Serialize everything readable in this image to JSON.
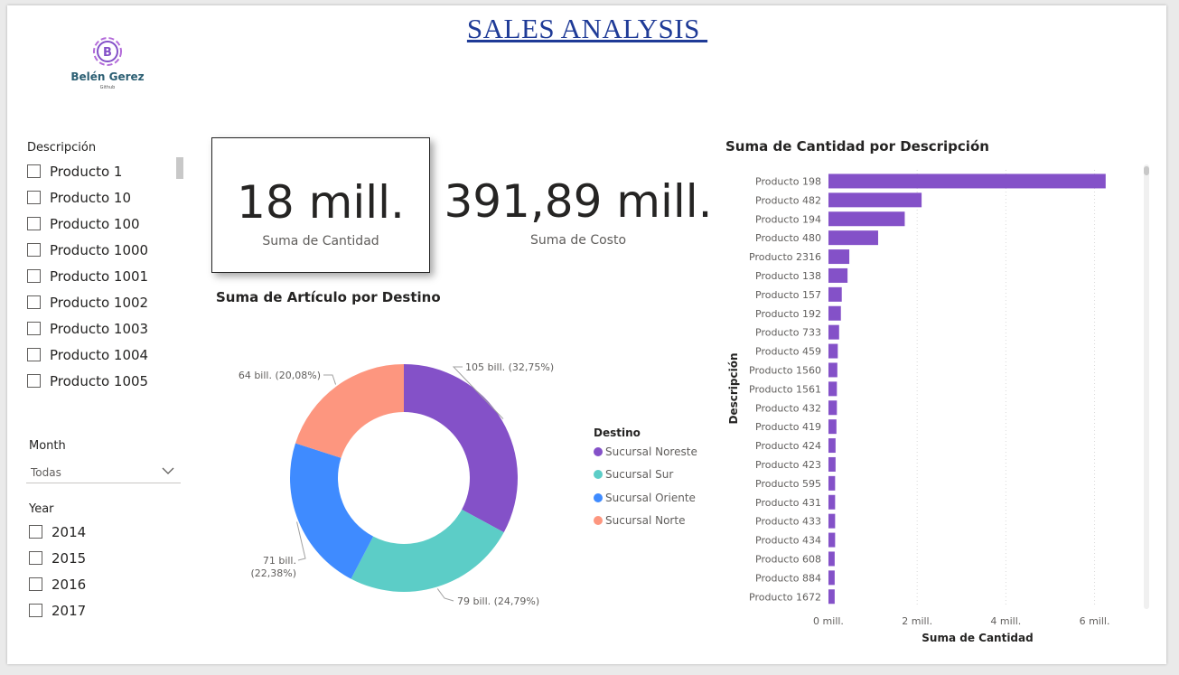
{
  "header": {
    "title": "SALES ANALYSIS "
  },
  "logo": {
    "letter": "B",
    "brand": "Belén Gerez",
    "sub": "Github"
  },
  "slicer_descripcion": {
    "title": "Descripción",
    "items": [
      "Producto 1",
      "Producto 10",
      "Producto 100",
      "Producto 1000",
      "Producto 1001",
      "Producto 1002",
      "Producto 1003",
      "Producto 1004",
      "Producto 1005"
    ]
  },
  "slicer_month": {
    "title": "Month",
    "value": "Todas"
  },
  "slicer_year": {
    "title": "Year",
    "items": [
      "2014",
      "2015",
      "2016",
      "2017"
    ]
  },
  "kpi_cantidad": {
    "value": "18 mill.",
    "label": "Suma de Cantidad"
  },
  "kpi_costo": {
    "value": "391,89 mill.",
    "label": "Suma de Costo"
  },
  "colors": {
    "purple": "#8451c8",
    "teal": "#5ccdc7",
    "blue": "#3f8bff",
    "salmon": "#fd967f",
    "title_blue": "#1f3b97"
  },
  "chart_data": [
    {
      "type": "pie",
      "title": "Suma de Artículo por Destino",
      "legend_title": "Destino",
      "legend_position": "right",
      "categories": [
        "Sucursal Noreste",
        "Sucursal Sur",
        "Sucursal Oriente",
        "Sucursal Norte"
      ],
      "values": [
        105,
        79,
        71,
        64
      ],
      "percents": [
        32.75,
        24.79,
        22.38,
        20.08
      ],
      "data_labels": [
        "105 bill. (32,75%)",
        "79 bill. (24,79%)",
        "71 bill.",
        "64 bill. (20,08%)"
      ],
      "data_label_extra": [
        "",
        "",
        "(22,38%)",
        ""
      ],
      "colors": [
        "#8451c8",
        "#5ccdc7",
        "#3f8bff",
        "#fd967f"
      ]
    },
    {
      "type": "bar",
      "orientation": "horizontal",
      "title": "Suma de Cantidad por Descripción",
      "xlabel": "Suma de Cantidad",
      "ylabel": "Descripción",
      "xlim": [
        0,
        6.6
      ],
      "xticks": [
        0,
        2,
        4,
        6
      ],
      "xtick_labels": [
        "0 mill.",
        "2 mill.",
        "4 mill.",
        "6 mill."
      ],
      "grid": true,
      "categories": [
        "Producto 198",
        "Producto 482",
        "Producto 194",
        "Producto 480",
        "Producto 2316",
        "Producto 138",
        "Producto 157",
        "Producto 192",
        "Producto 733",
        "Producto 459",
        "Producto 1560",
        "Producto 1561",
        "Producto 432",
        "Producto 419",
        "Producto 424",
        "Producto 423",
        "Producto 595",
        "Producto 431",
        "Producto 433",
        "Producto 434",
        "Producto 608",
        "Producto 884",
        "Producto 1672"
      ],
      "values": [
        6.25,
        2.1,
        1.72,
        1.12,
        0.47,
        0.43,
        0.3,
        0.28,
        0.24,
        0.21,
        0.2,
        0.19,
        0.19,
        0.18,
        0.16,
        0.16,
        0.15,
        0.15,
        0.15,
        0.15,
        0.14,
        0.14,
        0.14
      ],
      "color": "#8451c8"
    }
  ]
}
